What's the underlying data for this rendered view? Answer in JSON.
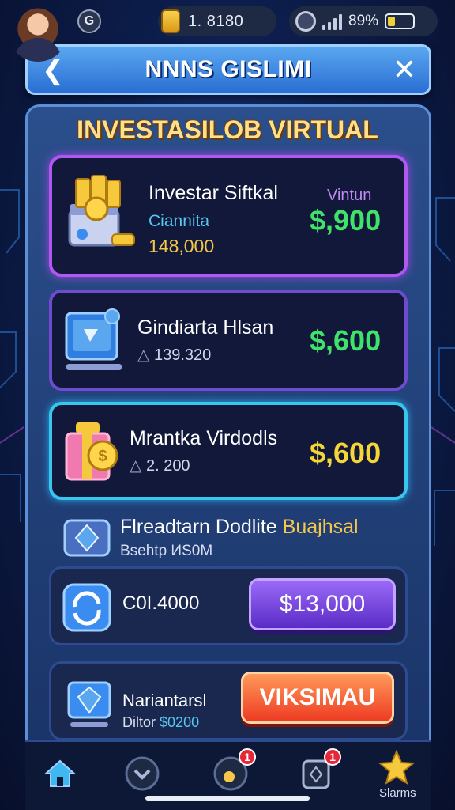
{
  "status_bar": {
    "coins": "1. 8180",
    "battery_percent": "89%",
    "battery_level": 0.3
  },
  "header": {
    "title": "NNNS GISLIMI"
  },
  "panel": {
    "title": "INVESTASILOB VIRTUAL"
  },
  "cards": [
    {
      "name": "Investar Siftkal",
      "tag": "Vintun",
      "subtitle": "Ciannita",
      "amount": "148,000",
      "price": "$,900",
      "price_color": "#3fe36a"
    },
    {
      "name": "Gindiarta Hlsan",
      "amount": "139.320",
      "price": "$,600",
      "price_color": "#3fe36a"
    },
    {
      "name": "Mrantka Virdodls",
      "amount": "2. 200",
      "price": "$,600",
      "price_color": "#f5d636"
    }
  ],
  "feature": {
    "name_white": "Flreadtarn Dodlite",
    "name_gold": "Buajhsal",
    "subtitle": "Bsehtp ИS0M"
  },
  "offer_row": {
    "amount": "C0I.4000",
    "button_label": "$13,000"
  },
  "action_row": {
    "name": "Nariantarsl",
    "sub_label": "Diltor",
    "sub_value": "$0200",
    "button_label": "VIKSIMAU"
  },
  "nav": {
    "badge_1": "1",
    "badge_2": "1",
    "star_label": "Slarms"
  },
  "colors": {
    "accent_gold": "#ffe08a",
    "accent_green": "#3fe36a",
    "accent_yellow": "#f5d636"
  }
}
